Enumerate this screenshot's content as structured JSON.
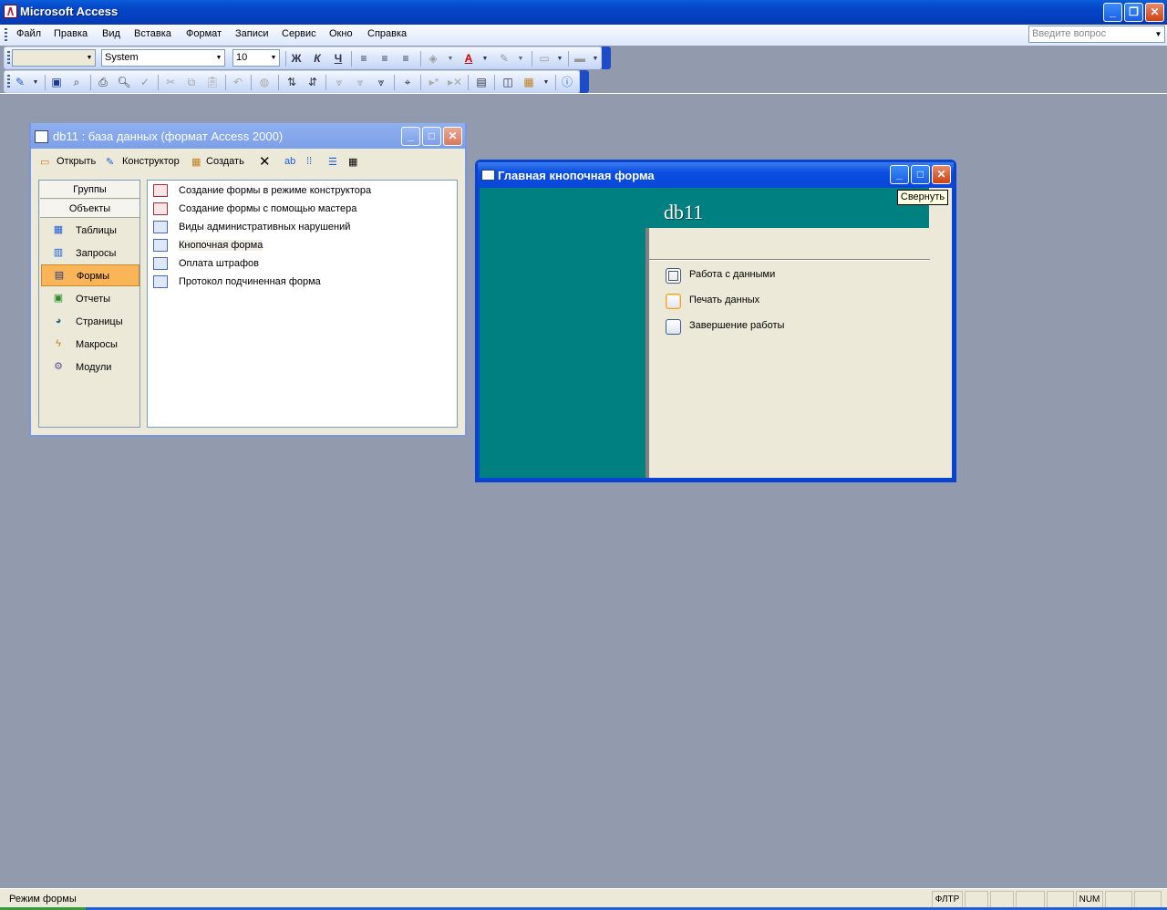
{
  "app": {
    "title": "Microsoft Access"
  },
  "menu": [
    "Файл",
    "Правка",
    "Вид",
    "Вставка",
    "Формат",
    "Записи",
    "Сервис",
    "Окно",
    "Справка"
  ],
  "ask_placeholder": "Введите вопрос",
  "format_toolbar": {
    "object_combo": "",
    "font": "System",
    "size": "10",
    "bold": "Ж",
    "italic": "К",
    "underline": "Ч",
    "font_color_glyph": "A"
  },
  "db_window": {
    "title": "db11 : база данных (формат Access 2000)",
    "toolbar": {
      "open": "Открыть",
      "design": "Конструктор",
      "create": "Создать"
    },
    "groups_label": "Группы",
    "objects_label": "Объекты",
    "objects": [
      "Таблицы",
      "Запросы",
      "Формы",
      "Отчеты",
      "Страницы",
      "Макросы",
      "Модули"
    ],
    "selected_object": "Формы",
    "items": [
      "Создание формы в режиме конструктора",
      "Создание формы с помощью мастера",
      "Виды административных нарушений",
      "Кнопочная форма",
      "Оплата штрафов",
      "Протокол подчиненная форма"
    ]
  },
  "switchboard": {
    "title": "Главная кнопочная форма",
    "header": "db11",
    "buttons": [
      "Работа с данными",
      "Печать данных",
      "Завершение работы"
    ],
    "tooltip": "Свернуть"
  },
  "status": {
    "mode": "Режим формы",
    "filter": "ФЛТР",
    "num": "NUM"
  },
  "colors": {
    "teal": "#008080",
    "selected": "#fbb559",
    "desktop": "#929aae"
  }
}
